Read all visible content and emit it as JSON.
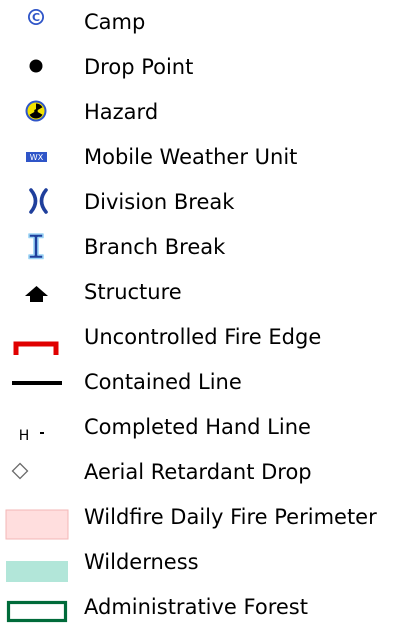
{
  "legend": {
    "items": [
      {
        "id": "camp",
        "label": "Camp",
        "icon": "camp-icon"
      },
      {
        "id": "drop-point",
        "label": "Drop Point",
        "icon": "drop-point-icon"
      },
      {
        "id": "hazard",
        "label": "Hazard",
        "icon": "hazard-icon"
      },
      {
        "id": "mobile-weather-unit",
        "label": "Mobile Weather Unit",
        "icon": "weather-unit-icon",
        "badge_text": "WX"
      },
      {
        "id": "division-break",
        "label": "Division Break",
        "icon": "division-break-icon"
      },
      {
        "id": "branch-break",
        "label": "Branch Break",
        "icon": "branch-break-icon"
      },
      {
        "id": "structure",
        "label": "Structure",
        "icon": "structure-icon"
      },
      {
        "id": "uncontrolled-fire-edge",
        "label": "Uncontrolled Fire Edge",
        "icon": "uncontrolled-fire-edge-icon"
      },
      {
        "id": "contained-line",
        "label": "Contained Line",
        "icon": "contained-line-icon"
      },
      {
        "id": "completed-hand-line",
        "label": "Completed Hand Line",
        "icon": "hand-line-icon",
        "symbol_text": "H"
      },
      {
        "id": "aerial-retardant-drop",
        "label": "Aerial Retardant Drop",
        "icon": "retardant-drop-icon"
      },
      {
        "id": "wildfire-daily-fire-perimeter",
        "label": "Wildfire Daily Fire Perimeter",
        "icon": "fire-perimeter-swatch"
      },
      {
        "id": "wilderness",
        "label": "Wilderness",
        "icon": "wilderness-swatch"
      },
      {
        "id": "administrative-forest",
        "label": "Administrative Forest",
        "icon": "administrative-forest-swatch"
      }
    ]
  },
  "colors": {
    "camp": "#2f55c8",
    "drop_point": "#000000",
    "hazard_fill": "#f2e200",
    "hazard_ring": "#2f55c8",
    "weather_unit": "#2f55c8",
    "division_break": "#1f3f9c",
    "branch_break_fill": "#1f3f9c",
    "branch_break_halo": "#9bd4f5",
    "fire_edge": "#e00000",
    "contained_line": "#000000",
    "fire_perimeter": "#ffdede",
    "fire_perimeter_border": "#f3b7b7",
    "wilderness": "#b2e6d9",
    "administrative_forest": "#006b3a"
  }
}
